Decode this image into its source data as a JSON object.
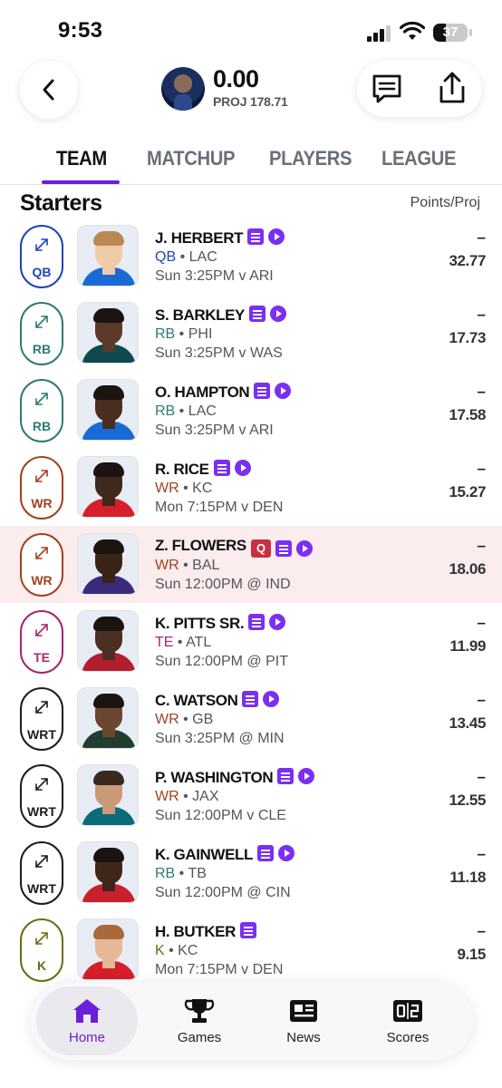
{
  "status_bar": {
    "time": "9:53",
    "battery": "37",
    "battery_level": 0.37
  },
  "header": {
    "score": "0.00",
    "projection": "PROJ 178.71"
  },
  "tabs": [
    {
      "label": "TEAM",
      "active": true
    },
    {
      "label": "MATCHUP",
      "active": false
    },
    {
      "label": "PLAYERS",
      "active": false
    },
    {
      "label": "LEAGUE",
      "active": false
    }
  ],
  "section": {
    "title": "Starters",
    "column_header": "Points/Proj"
  },
  "colors": {
    "accent": "#6a1fd8",
    "QB": "#1e44b8",
    "RB": "#2f7a74",
    "WR": "#a0431c",
    "TE": "#a2286c",
    "WRT": "#1c1c1c",
    "K": "#6f6a12",
    "alert_bg": "#fbecee",
    "injury_q": "#c8313f"
  },
  "starters": [
    {
      "slot": "QB",
      "name": "J. HERBERT",
      "position": "QB",
      "team": "LAC",
      "game": "Sun 3:25PM v ARI",
      "points": "–",
      "projection": "32.77",
      "injury": ""
    },
    {
      "slot": "RB",
      "name": "S. BARKLEY",
      "position": "RB",
      "team": "PHI",
      "game": "Sun 3:25PM v WAS",
      "points": "–",
      "projection": "17.73",
      "injury": ""
    },
    {
      "slot": "RB",
      "name": "O. HAMPTON",
      "position": "RB",
      "team": "LAC",
      "game": "Sun 3:25PM v ARI",
      "points": "–",
      "projection": "17.58",
      "injury": ""
    },
    {
      "slot": "WR",
      "name": "R. RICE",
      "position": "WR",
      "team": "KC",
      "game": "Mon 7:15PM v DEN",
      "points": "–",
      "projection": "15.27",
      "injury": ""
    },
    {
      "slot": "WR",
      "name": "Z. FLOWERS",
      "position": "WR",
      "team": "BAL",
      "game": "Sun 12:00PM @ IND",
      "points": "–",
      "projection": "18.06",
      "injury": "Q"
    },
    {
      "slot": "TE",
      "name": "K. PITTS SR.",
      "position": "TE",
      "team": "ATL",
      "game": "Sun 12:00PM @ PIT",
      "points": "–",
      "projection": "11.99",
      "injury": ""
    },
    {
      "slot": "WRT",
      "name": "C. WATSON",
      "position": "WR",
      "team": "GB",
      "game": "Sun 3:25PM @ MIN",
      "points": "–",
      "projection": "13.45",
      "injury": ""
    },
    {
      "slot": "WRT",
      "name": "P. WASHINGTON",
      "position": "WR",
      "team": "JAX",
      "game": "Sun 12:00PM v CLE",
      "points": "–",
      "projection": "12.55",
      "injury": ""
    },
    {
      "slot": "WRT",
      "name": "K. GAINWELL",
      "position": "RB",
      "team": "TB",
      "game": "Sun 12:00PM @ CIN",
      "points": "–",
      "projection": "11.18",
      "injury": ""
    },
    {
      "slot": "K",
      "name": "H. BUTKER",
      "position": "K",
      "team": "KC",
      "game": "Mon 7:15PM v DEN",
      "points": "–",
      "projection": "9.15",
      "injury": ""
    }
  ],
  "bottom_nav": [
    {
      "label": "Home",
      "icon": "home-icon",
      "active": true
    },
    {
      "label": "Games",
      "icon": "trophy-icon",
      "active": false
    },
    {
      "label": "News",
      "icon": "news-icon",
      "active": false
    },
    {
      "label": "Scores",
      "icon": "scores-icon",
      "active": false
    }
  ]
}
